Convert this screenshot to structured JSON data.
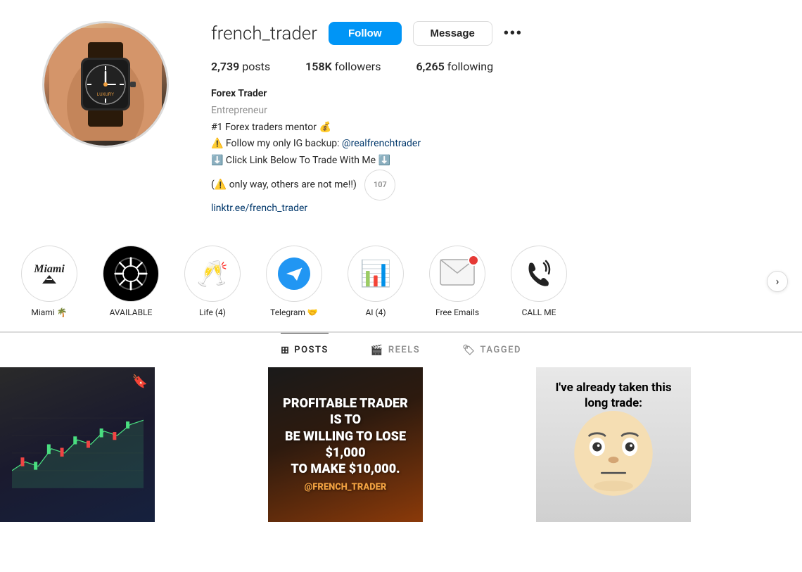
{
  "profile": {
    "username": "french_trader",
    "avatar_alt": "Profile photo showing a luxury watch",
    "stats": {
      "posts_count": "2,739",
      "posts_label": "posts",
      "followers_count": "158K",
      "followers_label": "followers",
      "following_count": "6,265",
      "following_label": "following"
    },
    "bio": {
      "name": "Forex Trader",
      "subtitle": "Entrepreneur",
      "line1": "#1 Forex traders mentor 💰",
      "line2": "⚠️ Follow my only IG backup: @realfrenchtrader",
      "line3": "⬇️ Click Link Below To Trade With Me ⬇️",
      "line4": "(⚠️ only way, others are not me!!)",
      "link_text": "linktr.ee/french_trader",
      "link_href": "https://linktr.ee/french_trader",
      "note_count": "107"
    },
    "buttons": {
      "follow": "Follow",
      "message": "Message",
      "more": "•••"
    }
  },
  "highlights": [
    {
      "id": "miami",
      "label": "Miami 🌴",
      "type": "text",
      "text": "Miami"
    },
    {
      "id": "available",
      "label": "AVAILABLE",
      "type": "aperture",
      "dark": true
    },
    {
      "id": "life",
      "label": "Life (4)",
      "type": "champagne"
    },
    {
      "id": "telegram",
      "label": "Telegram 🤝",
      "type": "telegram"
    },
    {
      "id": "ai",
      "label": "AI (4)",
      "type": "money"
    },
    {
      "id": "freeemails",
      "label": "Free Emails",
      "type": "email"
    },
    {
      "id": "callme",
      "label": "CALL ME",
      "type": "phone"
    }
  ],
  "tabs": [
    {
      "id": "posts",
      "label": "POSTS",
      "active": true,
      "icon": "grid"
    },
    {
      "id": "reels",
      "label": "REELS",
      "active": false,
      "icon": "film"
    },
    {
      "id": "tagged",
      "label": "TAGGED",
      "active": false,
      "icon": "tag"
    }
  ],
  "posts": [
    {
      "id": "post1",
      "type": "chart",
      "has_bookmark": true,
      "alt": "Trading chart on laptop"
    },
    {
      "id": "post2",
      "type": "text_overlay",
      "text_line1": "PROFITABLE TRADER IS TO",
      "text_line2": "BE WILLING TO LOSE $1,000",
      "text_line3": "TO MAKE $10,000.",
      "brand": "@FRENCH_TRADER",
      "alt": "Trading quote post"
    },
    {
      "id": "post3",
      "type": "meme",
      "text": "I've already taken this long trade:",
      "alt": "Meme post about trading"
    }
  ]
}
